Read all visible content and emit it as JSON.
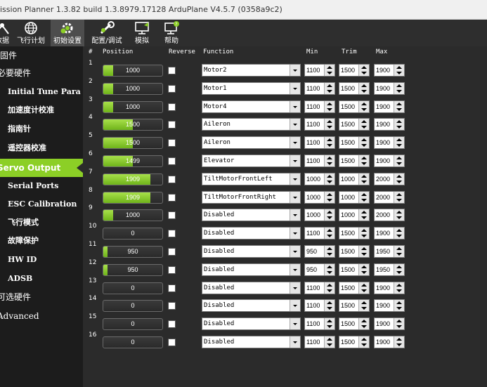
{
  "window": {
    "title": "ission Planner 1.3.82 build 1.3.8979.17128 ArduPlane V4.5.7 (0358a9c2)"
  },
  "toolbar": [
    {
      "label": "数据",
      "icon": "data-icon",
      "active": false
    },
    {
      "label": "飞行计划",
      "icon": "globe-icon",
      "active": false
    },
    {
      "label": "初始设置",
      "icon": "initial-setup-icon",
      "active": true
    },
    {
      "label": "配置/调试",
      "icon": "config-tuning-icon",
      "active": false
    },
    {
      "label": "模拟",
      "icon": "simulation-icon",
      "active": false
    },
    {
      "label": "帮助",
      "icon": "help-icon",
      "active": false
    }
  ],
  "sidebar": [
    {
      "label": "固件",
      "kind": "top"
    },
    {
      "label": "必要硬件",
      "kind": "top"
    },
    {
      "label": "Initial Tune Para",
      "kind": "sub"
    },
    {
      "label": "加速度计校准",
      "kind": "sub"
    },
    {
      "label": "指南针",
      "kind": "sub"
    },
    {
      "label": "遥控器校准",
      "kind": "sub"
    },
    {
      "label": "Servo Output",
      "kind": "active"
    },
    {
      "label": "Serial Ports",
      "kind": "sub"
    },
    {
      "label": "ESC Calibration",
      "kind": "sub"
    },
    {
      "label": "飞行模式",
      "kind": "sub"
    },
    {
      "label": "故障保护",
      "kind": "sub"
    },
    {
      "label": "HW ID",
      "kind": "sub"
    },
    {
      "label": "ADSB",
      "kind": "sub"
    },
    {
      "label": "可选硬件",
      "kind": "top"
    },
    {
      "label": "Advanced",
      "kind": "top"
    }
  ],
  "headers": {
    "num": "#",
    "position": "Position",
    "reverse": "Reverse",
    "function": "Function",
    "min": "Min",
    "trim": "Trim",
    "max": "Max"
  },
  "servos": [
    {
      "num": "1",
      "position": "1000",
      "fill": 0.17,
      "function": "Motor2",
      "min": "1100",
      "trim": "1500",
      "max": "1900"
    },
    {
      "num": "2",
      "position": "1000",
      "fill": 0.17,
      "function": "Motor1",
      "min": "1100",
      "trim": "1500",
      "max": "1900"
    },
    {
      "num": "3",
      "position": "1000",
      "fill": 0.17,
      "function": "Motor4",
      "min": "1100",
      "trim": "1500",
      "max": "1900"
    },
    {
      "num": "4",
      "position": "1500",
      "fill": 0.5,
      "function": "Aileron",
      "min": "1100",
      "trim": "1500",
      "max": "1900"
    },
    {
      "num": "5",
      "position": "1500",
      "fill": 0.5,
      "function": "Aileron",
      "min": "1100",
      "trim": "1500",
      "max": "1900"
    },
    {
      "num": "6",
      "position": "1499",
      "fill": 0.5,
      "function": "Elevator",
      "min": "1100",
      "trim": "1500",
      "max": "1900"
    },
    {
      "num": "7",
      "position": "1909",
      "fill": 0.8,
      "function": "TiltMotorFrontLeft",
      "min": "1000",
      "trim": "1000",
      "max": "2000"
    },
    {
      "num": "8",
      "position": "1909",
      "fill": 0.8,
      "function": "TiltMotorFrontRight",
      "min": "1000",
      "trim": "1000",
      "max": "2000"
    },
    {
      "num": "9",
      "position": "1000",
      "fill": 0.17,
      "function": "Disabled",
      "min": "1000",
      "trim": "1000",
      "max": "2000"
    },
    {
      "num": "10",
      "position": "0",
      "fill": 0,
      "function": "Disabled",
      "min": "1100",
      "trim": "1500",
      "max": "1900"
    },
    {
      "num": "11",
      "position": "950",
      "fill": 0.07,
      "function": "Disabled",
      "min": "950",
      "trim": "1500",
      "max": "1950"
    },
    {
      "num": "12",
      "position": "950",
      "fill": 0.07,
      "function": "Disabled",
      "min": "950",
      "trim": "1500",
      "max": "1950"
    },
    {
      "num": "13",
      "position": "0",
      "fill": 0,
      "function": "Disabled",
      "min": "1100",
      "trim": "1500",
      "max": "1900"
    },
    {
      "num": "14",
      "position": "0",
      "fill": 0,
      "function": "Disabled",
      "min": "1100",
      "trim": "1500",
      "max": "1900"
    },
    {
      "num": "15",
      "position": "0",
      "fill": 0,
      "function": "Disabled",
      "min": "1100",
      "trim": "1500",
      "max": "1900"
    },
    {
      "num": "16",
      "position": "0",
      "fill": 0,
      "function": "Disabled",
      "min": "1100",
      "trim": "1500",
      "max": "1900"
    }
  ]
}
